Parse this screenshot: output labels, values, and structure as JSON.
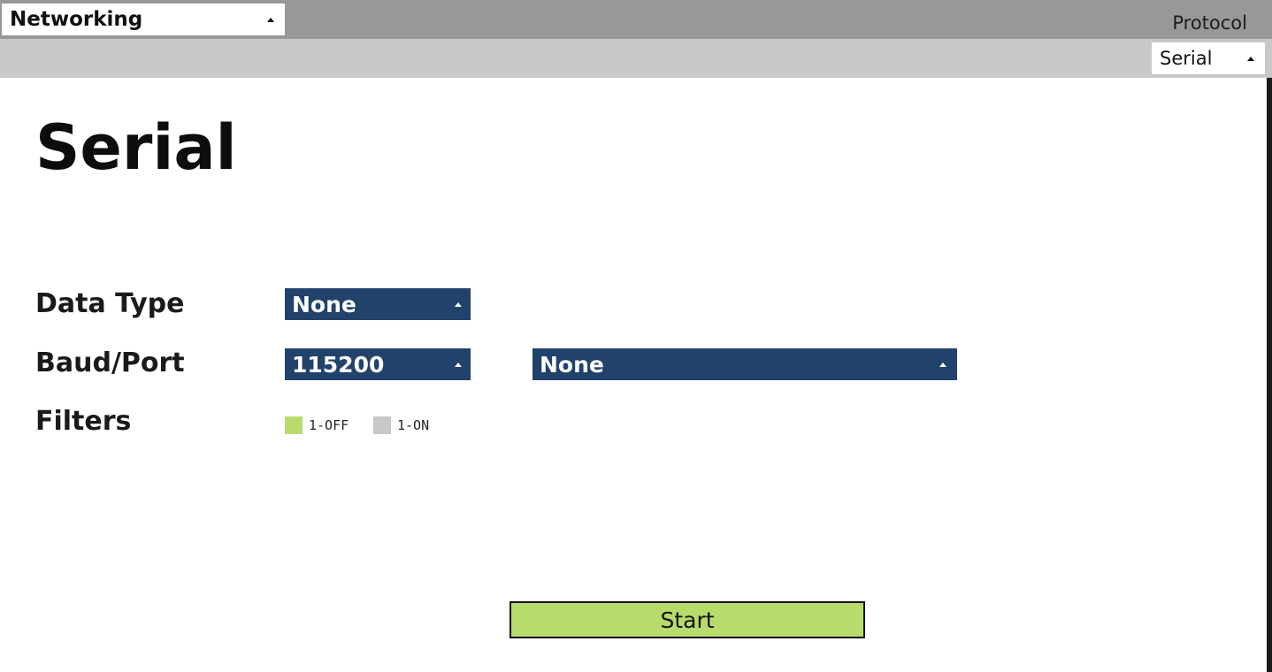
{
  "header": {
    "section_value": "Networking",
    "protocol_label": "Protocol",
    "protocol_value": "Serial"
  },
  "main": {
    "title": "Serial",
    "data_type": {
      "label": "Data Type",
      "value": "None"
    },
    "baud_port": {
      "label": "Baud/Port",
      "baud_value": "115200",
      "port_value": "None"
    },
    "filters": {
      "label": "Filters",
      "items": [
        {
          "label": "1-OFF",
          "color": "#b8dc6c"
        },
        {
          "label": "1-ON",
          "color": "#c8c8c8"
        }
      ]
    },
    "start_label": "Start"
  },
  "colors": {
    "dropdown_blue": "#21436b",
    "accent_green": "#b8dc6c",
    "topbar_gray": "#989898",
    "subbar_gray": "#c8c8c8"
  },
  "icons": {
    "dropdown_caret": "caret-up-icon"
  }
}
